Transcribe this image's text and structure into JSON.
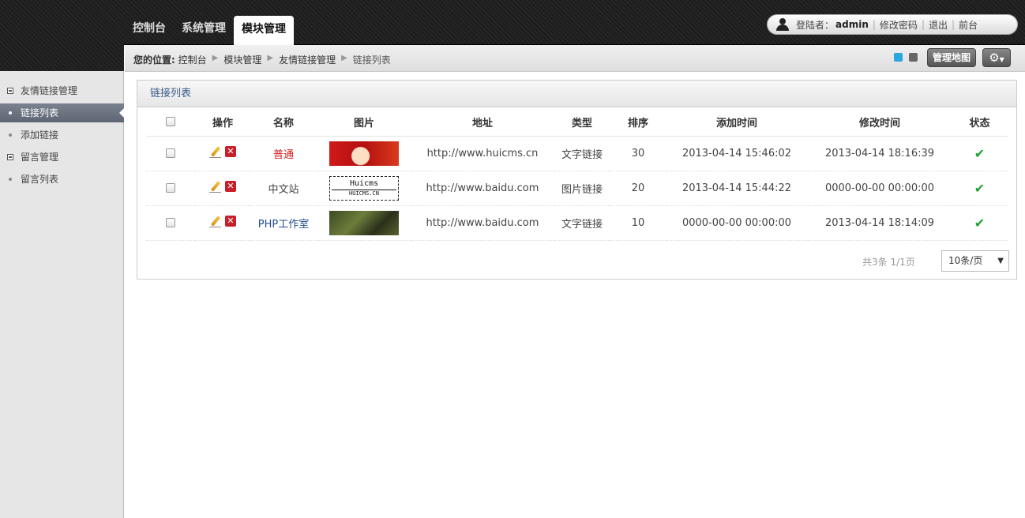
{
  "header": {
    "tabs": [
      "控制台",
      "系统管理",
      "模块管理"
    ],
    "user_prefix": "登陆者：",
    "username": "admin",
    "change_pwd": "修改密码",
    "logout": "退出",
    "frontend": "前台"
  },
  "breadcrumb": {
    "label": "您的位置:",
    "items": [
      "控制台",
      "模块管理",
      "友情链接管理",
      "链接列表"
    ],
    "map_button": "管理地图",
    "gear_icon": "⚙"
  },
  "sidebar": {
    "items": [
      {
        "label": "友情链接管理",
        "type": "group"
      },
      {
        "label": "链接列表",
        "type": "item",
        "active": true
      },
      {
        "label": "添加链接",
        "type": "item"
      },
      {
        "label": "留言管理",
        "type": "group"
      },
      {
        "label": "留言列表",
        "type": "item"
      }
    ]
  },
  "panel": {
    "title": "链接列表",
    "columns": [
      "操作",
      "名称",
      "图片",
      "地址",
      "类型",
      "排序",
      "添加时间",
      "修改时间",
      "状态"
    ],
    "rows": [
      {
        "name": "普通",
        "image_text": "",
        "url": "http://www.huicms.cn",
        "type": "文字链接",
        "order": "30",
        "added": "2013-04-14 15:46:02",
        "modified": "2013-04-14 18:16:39"
      },
      {
        "name": "中文站",
        "image_text": "Huicms",
        "image_sub": "HUICMS.CN",
        "url": "http://www.baidu.com",
        "type": "图片链接",
        "order": "20",
        "added": "2013-04-14 15:44:22",
        "modified": "0000-00-00 00:00:00"
      },
      {
        "name": "PHP工作室",
        "image_text": "",
        "url": "http://www.baidu.com",
        "type": "文字链接",
        "order": "10",
        "added": "0000-00-00 00:00:00",
        "modified": "2013-04-14 18:14:09"
      }
    ],
    "count_text": "共3条 1/1页",
    "page_size": "10条/页"
  }
}
